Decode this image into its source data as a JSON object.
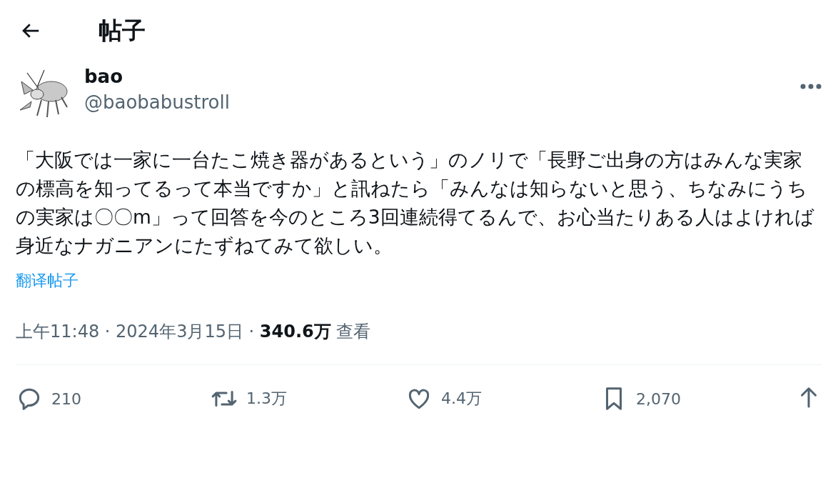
{
  "header": {
    "title": "帖子"
  },
  "author": {
    "name": "bao",
    "handle": "@baobabustroll"
  },
  "post": {
    "text": "「大阪では一家に一台たこ焼き器があるという」のノリで「長野ご出身の方はみんな実家の標高を知ってるって本当ですか」と訊ねたら「みんなは知らないと思う、ちなみにうちの実家は〇〇m」って回答を今のところ3回連続得てるんで、お心当たりある人はよければ身近なナガニアンにたずねてみて欲しい。",
    "translate": "翻译帖子",
    "meta": "上午11:48 · 2024年3月15日 · **340.6万** 查看"
  },
  "actions": [
    {
      "kind": "reply",
      "count": "210"
    },
    {
      "kind": "repost",
      "count": "1.3万"
    },
    {
      "kind": "like",
      "count": "4.4万"
    },
    {
      "kind": "bookmark",
      "count": "2,070"
    },
    {
      "kind": "share"
    }
  ]
}
